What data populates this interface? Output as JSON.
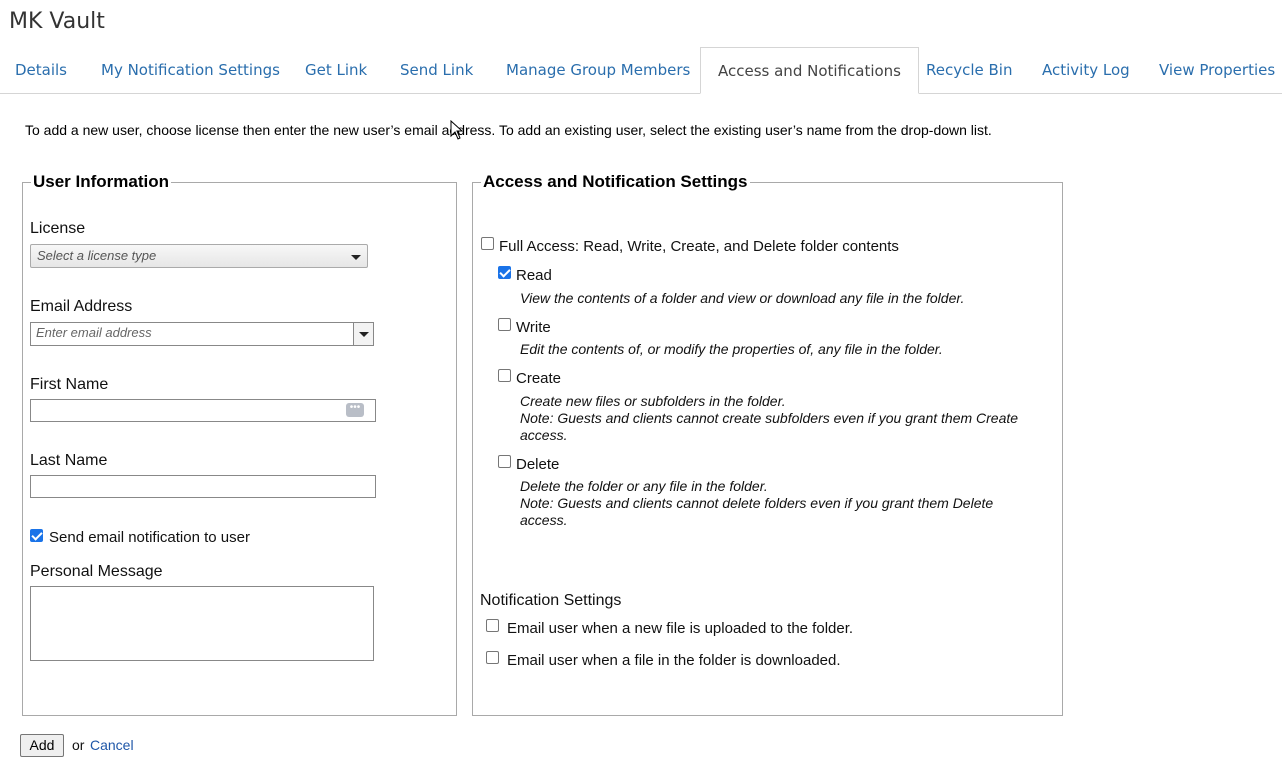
{
  "app": {
    "title": "MK Vault"
  },
  "tabs": [
    {
      "label": "Details",
      "active": false
    },
    {
      "label": "My Notification Settings",
      "active": false
    },
    {
      "label": "Get Link",
      "active": false
    },
    {
      "label": "Send Link",
      "active": false
    },
    {
      "label": "Manage Group Members",
      "active": false
    },
    {
      "label": "Access and Notifications",
      "active": true
    },
    {
      "label": "Recycle Bin",
      "active": false
    },
    {
      "label": "Activity Log",
      "active": false
    },
    {
      "label": "View Properties",
      "active": false
    }
  ],
  "intro": "To add a new user, choose license then enter the new user’s email address. To add an existing user, select the existing user’s name from the drop-down list.",
  "user_info": {
    "legend": "User Information",
    "license_label": "License",
    "license_placeholder": "Select a license type",
    "email_label": "Email Address",
    "email_placeholder": "Enter email address",
    "first_name_label": "First Name",
    "first_name_value": "",
    "last_name_label": "Last Name",
    "last_name_value": "",
    "send_notification_label": "Send email notification to user",
    "send_notification_checked": true,
    "personal_message_label": "Personal Message",
    "personal_message_value": ""
  },
  "access": {
    "legend": "Access and Notification Settings",
    "full_access": {
      "label": "Full Access: Read, Write, Create, and Delete folder contents",
      "checked": false
    },
    "permissions": [
      {
        "label": "Read",
        "checked": true,
        "desc": [
          "View the contents of a folder and view or download any file in the folder."
        ]
      },
      {
        "label": "Write",
        "checked": false,
        "desc": [
          "Edit the contents of, or modify the properties of, any file in the folder."
        ]
      },
      {
        "label": "Create",
        "checked": false,
        "desc": [
          "Create new files or subfolders in the folder.",
          "Note: Guests and clients cannot create subfolders even if you grant them Create access."
        ]
      },
      {
        "label": "Delete",
        "checked": false,
        "desc": [
          "Delete the folder or any file in the folder.",
          "Note: Guests and clients cannot delete folders even if you grant them Delete access."
        ]
      }
    ],
    "notification_heading": "Notification Settings",
    "notifications": [
      {
        "label": "Email user when a new file is uploaded to the folder.",
        "checked": false
      },
      {
        "label": "Email user when a file in the folder is downloaded.",
        "checked": false
      }
    ]
  },
  "actions": {
    "add_label": "Add",
    "or_text": "or",
    "cancel_label": "Cancel"
  },
  "colors": {
    "link": "#2a6ead",
    "checkbox_checked": "#1a73e8"
  }
}
